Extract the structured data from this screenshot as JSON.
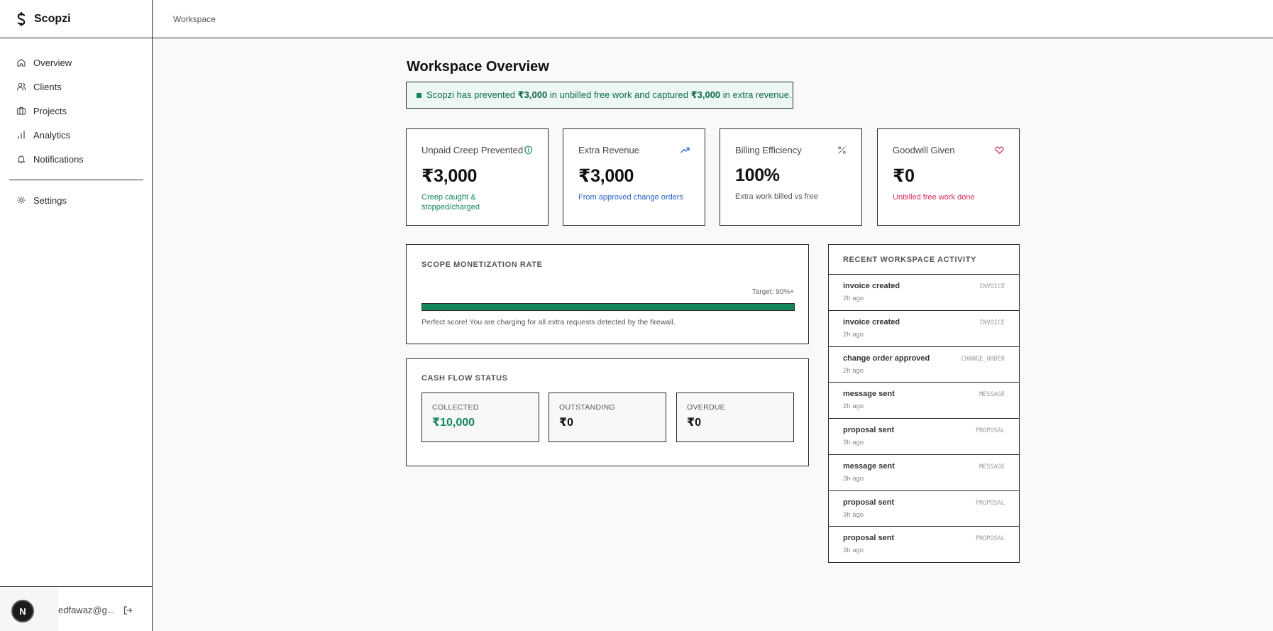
{
  "app": {
    "name": "Scopzi",
    "breadcrumb": "Workspace"
  },
  "sidebar": {
    "items": [
      {
        "label": "Overview",
        "icon": "home-icon"
      },
      {
        "label": "Clients",
        "icon": "users-icon"
      },
      {
        "label": "Projects",
        "icon": "briefcase-icon"
      },
      {
        "label": "Analytics",
        "icon": "bar-chart-icon"
      },
      {
        "label": "Notifications",
        "icon": "bell-icon"
      }
    ],
    "settings": {
      "label": "Settings",
      "icon": "gear-icon"
    },
    "user": {
      "initial": "N",
      "email": "edfawaz@g..."
    }
  },
  "page": {
    "title": "Workspace Overview",
    "banner": {
      "prefix": "Scopzi has prevented ",
      "amount1": "₹3,000",
      "middle": " in unbilled free work and captured ",
      "amount2": "₹3,000",
      "suffix": " in extra revenue."
    }
  },
  "stats": [
    {
      "title": "Unpaid Creep Prevented",
      "value": "₹3,000",
      "sub": "Creep caught & stopped/charged",
      "icon": "shield-icon",
      "color": "#13875a"
    },
    {
      "title": "Extra Revenue",
      "value": "₹3,000",
      "sub": "From approved change orders",
      "icon": "trending-up-icon",
      "color": "#2563c7"
    },
    {
      "title": "Billing Efficiency",
      "value": "100%",
      "sub": "Extra work billed vs free",
      "icon": "percent-icon",
      "color": "#555555"
    },
    {
      "title": "Goodwill Given",
      "value": "₹0",
      "sub": "Unbilled free work done",
      "icon": "heart-icon",
      "color": "#d62d5a"
    }
  ],
  "rate": {
    "title": "SCOPE MONETIZATION RATE",
    "target": "Target: 90%+",
    "fill_percent": 100,
    "note": "Perfect score! You are charging for all extra requests detected by the firewall."
  },
  "cashflow": {
    "title": "CASH FLOW STATUS",
    "boxes": [
      {
        "label": "COLLECTED",
        "value": "₹10,000"
      },
      {
        "label": "OUTSTANDING",
        "value": "₹0"
      },
      {
        "label": "OVERDUE",
        "value": "₹0"
      }
    ]
  },
  "activity": {
    "title": "RECENT WORKSPACE ACTIVITY",
    "items": [
      {
        "name": "invoice created",
        "time": "2h ago",
        "tag": "INVOICE"
      },
      {
        "name": "invoice created",
        "time": "2h ago",
        "tag": "INVOICE"
      },
      {
        "name": "change order approved",
        "time": "2h ago",
        "tag": "CHANGE_ORDER"
      },
      {
        "name": "message sent",
        "time": "2h ago",
        "tag": "MESSAGE"
      },
      {
        "name": "proposal sent",
        "time": "3h ago",
        "tag": "PROPOSAL"
      },
      {
        "name": "message sent",
        "time": "3h ago",
        "tag": "MESSAGE"
      },
      {
        "name": "proposal sent",
        "time": "3h ago",
        "tag": "PROPOSAL"
      },
      {
        "name": "proposal sent",
        "time": "3h ago",
        "tag": "PROPOSAL"
      }
    ]
  }
}
